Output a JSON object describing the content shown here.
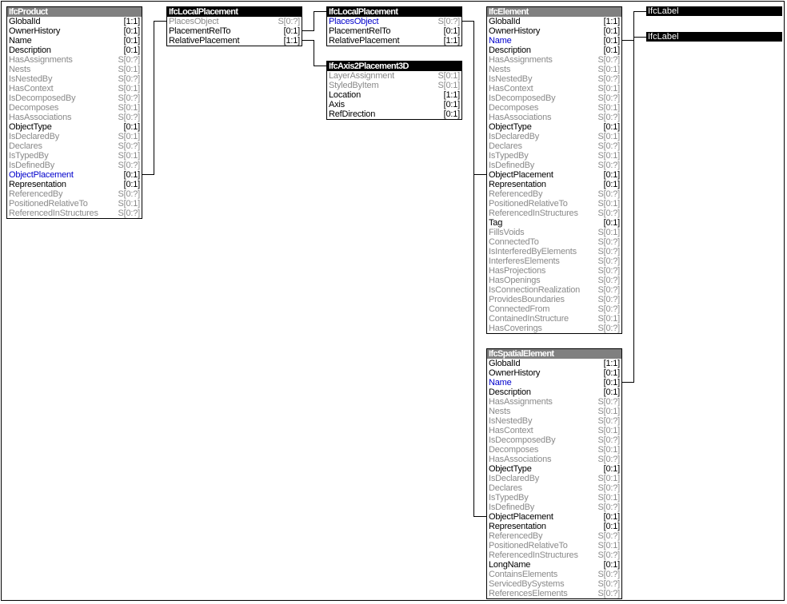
{
  "diagram": {
    "entities": [
      {
        "id": "ifcproduct",
        "name": "IfcProduct",
        "header_style": "gray",
        "attributes": [
          {
            "name": "GlobalId",
            "card": "[1:1]",
            "kind": "attr"
          },
          {
            "name": "OwnerHistory",
            "card": "[0:1]",
            "kind": "attr"
          },
          {
            "name": "Name",
            "card": "[0:1]",
            "kind": "attr"
          },
          {
            "name": "Description",
            "card": "[0:1]",
            "kind": "attr"
          },
          {
            "name": "HasAssignments",
            "card": "S[0:?]",
            "kind": "inv"
          },
          {
            "name": "Nests",
            "card": "S[0:1]",
            "kind": "inv"
          },
          {
            "name": "IsNestedBy",
            "card": "S[0:?]",
            "kind": "inv"
          },
          {
            "name": "HasContext",
            "card": "S[0:1]",
            "kind": "inv"
          },
          {
            "name": "IsDecomposedBy",
            "card": "S[0:?]",
            "kind": "inv"
          },
          {
            "name": "Decomposes",
            "card": "S[0:1]",
            "kind": "inv"
          },
          {
            "name": "HasAssociations",
            "card": "S[0:?]",
            "kind": "inv"
          },
          {
            "name": "ObjectType",
            "card": "[0:1]",
            "kind": "attr"
          },
          {
            "name": "IsDeclaredBy",
            "card": "S[0:1]",
            "kind": "inv"
          },
          {
            "name": "Declares",
            "card": "S[0:?]",
            "kind": "inv"
          },
          {
            "name": "IsTypedBy",
            "card": "S[0:1]",
            "kind": "inv"
          },
          {
            "name": "IsDefinedBy",
            "card": "S[0:?]",
            "kind": "inv"
          },
          {
            "name": "ObjectPlacement",
            "card": "[0:1]",
            "kind": "link"
          },
          {
            "name": "Representation",
            "card": "[0:1]",
            "kind": "attr"
          },
          {
            "name": "ReferencedBy",
            "card": "S[0:?]",
            "kind": "inv"
          },
          {
            "name": "PositionedRelativeTo",
            "card": "S[0:1]",
            "kind": "inv"
          },
          {
            "name": "ReferencedInStructures",
            "card": "S[0:?]",
            "kind": "inv"
          }
        ]
      },
      {
        "id": "ifclocalplacement-1",
        "name": "IfcLocalPlacement",
        "header_style": "black",
        "attributes": [
          {
            "name": "PlacesObject",
            "card": "S[0:?]",
            "kind": "inv"
          },
          {
            "name": "PlacementRelTo",
            "card": "[0:1]",
            "kind": "attr"
          },
          {
            "name": "RelativePlacement",
            "card": "[1:1]",
            "kind": "attr"
          }
        ]
      },
      {
        "id": "ifclocalplacement-2",
        "name": "IfcLocalPlacement",
        "header_style": "black",
        "attributes": [
          {
            "name": "PlacesObject",
            "card": "S[0:?]",
            "kind": "invlink"
          },
          {
            "name": "PlacementRelTo",
            "card": "[0:1]",
            "kind": "attr"
          },
          {
            "name": "RelativePlacement",
            "card": "[1:1]",
            "kind": "attr"
          }
        ]
      },
      {
        "id": "ifcaxis2placement3d",
        "name": "IfcAxis2Placement3D",
        "header_style": "black",
        "attributes": [
          {
            "name": "LayerAssignment",
            "card": "S[0:1]",
            "kind": "inv"
          },
          {
            "name": "StyledByItem",
            "card": "S[0:1]",
            "kind": "inv"
          },
          {
            "name": "Location",
            "card": "[1:1]",
            "kind": "attr"
          },
          {
            "name": "Axis",
            "card": "[0:1]",
            "kind": "attr"
          },
          {
            "name": "RefDirection",
            "card": "[0:1]",
            "kind": "attr"
          }
        ]
      },
      {
        "id": "ifcelement",
        "name": "IfcElement",
        "header_style": "gray",
        "attributes": [
          {
            "name": "GlobalId",
            "card": "[1:1]",
            "kind": "attr"
          },
          {
            "name": "OwnerHistory",
            "card": "[0:1]",
            "kind": "attr"
          },
          {
            "name": "Name",
            "card": "[0:1]",
            "kind": "link"
          },
          {
            "name": "Description",
            "card": "[0:1]",
            "kind": "attr"
          },
          {
            "name": "HasAssignments",
            "card": "S[0:?]",
            "kind": "inv"
          },
          {
            "name": "Nests",
            "card": "S[0:1]",
            "kind": "inv"
          },
          {
            "name": "IsNestedBy",
            "card": "S[0:?]",
            "kind": "inv"
          },
          {
            "name": "HasContext",
            "card": "S[0:1]",
            "kind": "inv"
          },
          {
            "name": "IsDecomposedBy",
            "card": "S[0:?]",
            "kind": "inv"
          },
          {
            "name": "Decomposes",
            "card": "S[0:1]",
            "kind": "inv"
          },
          {
            "name": "HasAssociations",
            "card": "S[0:?]",
            "kind": "inv"
          },
          {
            "name": "ObjectType",
            "card": "[0:1]",
            "kind": "attr"
          },
          {
            "name": "IsDeclaredBy",
            "card": "S[0:1]",
            "kind": "inv"
          },
          {
            "name": "Declares",
            "card": "S[0:?]",
            "kind": "inv"
          },
          {
            "name": "IsTypedBy",
            "card": "S[0:1]",
            "kind": "inv"
          },
          {
            "name": "IsDefinedBy",
            "card": "S[0:?]",
            "kind": "inv"
          },
          {
            "name": "ObjectPlacement",
            "card": "[0:1]",
            "kind": "attr"
          },
          {
            "name": "Representation",
            "card": "[0:1]",
            "kind": "attr"
          },
          {
            "name": "ReferencedBy",
            "card": "S[0:?]",
            "kind": "inv"
          },
          {
            "name": "PositionedRelativeTo",
            "card": "S[0:1]",
            "kind": "inv"
          },
          {
            "name": "ReferencedInStructures",
            "card": "S[0:?]",
            "kind": "inv"
          },
          {
            "name": "Tag",
            "card": "[0:1]",
            "kind": "attr"
          },
          {
            "name": "FillsVoids",
            "card": "S[0:1]",
            "kind": "inv"
          },
          {
            "name": "ConnectedTo",
            "card": "S[0:?]",
            "kind": "inv"
          },
          {
            "name": "IsInterferedByElements",
            "card": "S[0:?]",
            "kind": "inv"
          },
          {
            "name": "InterferesElements",
            "card": "S[0:?]",
            "kind": "inv"
          },
          {
            "name": "HasProjections",
            "card": "S[0:?]",
            "kind": "inv"
          },
          {
            "name": "HasOpenings",
            "card": "S[0:?]",
            "kind": "inv"
          },
          {
            "name": "IsConnectionRealization",
            "card": "S[0:?]",
            "kind": "inv"
          },
          {
            "name": "ProvidesBoundaries",
            "card": "S[0:?]",
            "kind": "inv"
          },
          {
            "name": "ConnectedFrom",
            "card": "S[0:?]",
            "kind": "inv"
          },
          {
            "name": "ContainedInStructure",
            "card": "S[0:1]",
            "kind": "inv"
          },
          {
            "name": "HasCoverings",
            "card": "S[0:?]",
            "kind": "inv"
          }
        ]
      },
      {
        "id": "ifcspatialelement",
        "name": "IfcSpatialElement",
        "header_style": "gray",
        "attributes": [
          {
            "name": "GlobalId",
            "card": "[1:1]",
            "kind": "attr"
          },
          {
            "name": "OwnerHistory",
            "card": "[0:1]",
            "kind": "attr"
          },
          {
            "name": "Name",
            "card": "[0:1]",
            "kind": "link"
          },
          {
            "name": "Description",
            "card": "[0:1]",
            "kind": "attr"
          },
          {
            "name": "HasAssignments",
            "card": "S[0:?]",
            "kind": "inv"
          },
          {
            "name": "Nests",
            "card": "S[0:1]",
            "kind": "inv"
          },
          {
            "name": "IsNestedBy",
            "card": "S[0:?]",
            "kind": "inv"
          },
          {
            "name": "HasContext",
            "card": "S[0:1]",
            "kind": "inv"
          },
          {
            "name": "IsDecomposedBy",
            "card": "S[0:?]",
            "kind": "inv"
          },
          {
            "name": "Decomposes",
            "card": "S[0:1]",
            "kind": "inv"
          },
          {
            "name": "HasAssociations",
            "card": "S[0:?]",
            "kind": "inv"
          },
          {
            "name": "ObjectType",
            "card": "[0:1]",
            "kind": "attr"
          },
          {
            "name": "IsDeclaredBy",
            "card": "S[0:1]",
            "kind": "inv"
          },
          {
            "name": "Declares",
            "card": "S[0:?]",
            "kind": "inv"
          },
          {
            "name": "IsTypedBy",
            "card": "S[0:1]",
            "kind": "inv"
          },
          {
            "name": "IsDefinedBy",
            "card": "S[0:?]",
            "kind": "inv"
          },
          {
            "name": "ObjectPlacement",
            "card": "[0:1]",
            "kind": "attr"
          },
          {
            "name": "Representation",
            "card": "[0:1]",
            "kind": "attr"
          },
          {
            "name": "ReferencedBy",
            "card": "S[0:?]",
            "kind": "inv"
          },
          {
            "name": "PositionedRelativeTo",
            "card": "S[0:1]",
            "kind": "inv"
          },
          {
            "name": "ReferencedInStructures",
            "card": "S[0:?]",
            "kind": "inv"
          },
          {
            "name": "LongName",
            "card": "[0:1]",
            "kind": "attr"
          },
          {
            "name": "ContainsElements",
            "card": "S[0:?]",
            "kind": "inv"
          },
          {
            "name": "ServicedBySystems",
            "card": "S[0:?]",
            "kind": "inv"
          },
          {
            "name": "ReferencesElements",
            "card": "S[0:?]",
            "kind": "inv"
          }
        ]
      }
    ],
    "type_labels": [
      {
        "id": "ifclabel-1",
        "name": "IfcLabel"
      },
      {
        "id": "ifclabel-2",
        "name": "IfcLabel"
      }
    ],
    "colors": {
      "header_gray": "#808080",
      "header_black": "#000000",
      "attribute": "#000000",
      "inverse_attribute": "#8a8a8a",
      "linked_attribute": "#0000cc"
    }
  }
}
